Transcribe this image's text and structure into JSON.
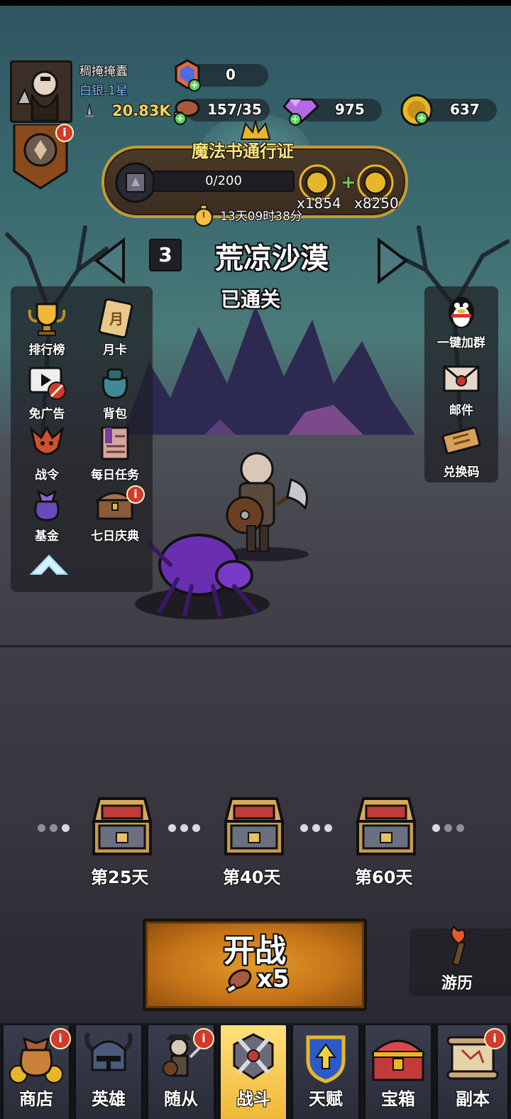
{
  "player": {
    "name": "稠掩掩蠹",
    "rank": "白银-1星",
    "power": "20.83K"
  },
  "resources": {
    "gem_tickets": "0",
    "stamina": "157/35",
    "diamonds": "975",
    "gold": "637"
  },
  "pass": {
    "title": "魔法书通行证",
    "progress": "0/200",
    "reward1": "x1854",
    "reward2": "x8250",
    "timer": "13天09时38分"
  },
  "stage": {
    "number": "3",
    "name": "荒凉沙漠",
    "status": "已通关"
  },
  "left_menu": [
    {
      "label": "排行榜",
      "icon": "trophy-icon"
    },
    {
      "label": "月卡",
      "icon": "month-card-icon"
    },
    {
      "label": "免广告",
      "icon": "no-ads-icon"
    },
    {
      "label": "背包",
      "icon": "backpack-icon"
    },
    {
      "label": "战令",
      "icon": "battle-order-icon"
    },
    {
      "label": "每日任务",
      "icon": "daily-task-icon"
    },
    {
      "label": "基金",
      "icon": "fund-bag-icon"
    },
    {
      "label": "七日庆典",
      "icon": "seven-day-chest-icon"
    }
  ],
  "right_menu": [
    {
      "label": "一键加群",
      "icon": "qq-penguin-icon"
    },
    {
      "label": "邮件",
      "icon": "mail-icon"
    },
    {
      "label": "兑换码",
      "icon": "coupon-icon"
    }
  ],
  "chests": [
    {
      "label": "第25天"
    },
    {
      "label": "第40天"
    },
    {
      "label": "第60天"
    }
  ],
  "fight": {
    "label": "开战",
    "cost": "x5"
  },
  "explore": {
    "label": "游历"
  },
  "nav": [
    {
      "label": "商店",
      "icon": "shop-bag-icon"
    },
    {
      "label": "英雄",
      "icon": "hero-helmet-icon"
    },
    {
      "label": "随从",
      "icon": "follower-icon"
    },
    {
      "label": "战斗",
      "icon": "battle-swords-icon"
    },
    {
      "label": "天赋",
      "icon": "talent-shield-icon"
    },
    {
      "label": "宝箱",
      "icon": "treasure-chest-icon"
    },
    {
      "label": "副本",
      "icon": "dungeon-scroll-icon"
    }
  ],
  "badge_text": "i",
  "colors": {
    "gold_text": "#f6d25a",
    "rank_text": "#7ec0ff",
    "nav_active": "#f0b838",
    "badge": "#d23a2a"
  }
}
